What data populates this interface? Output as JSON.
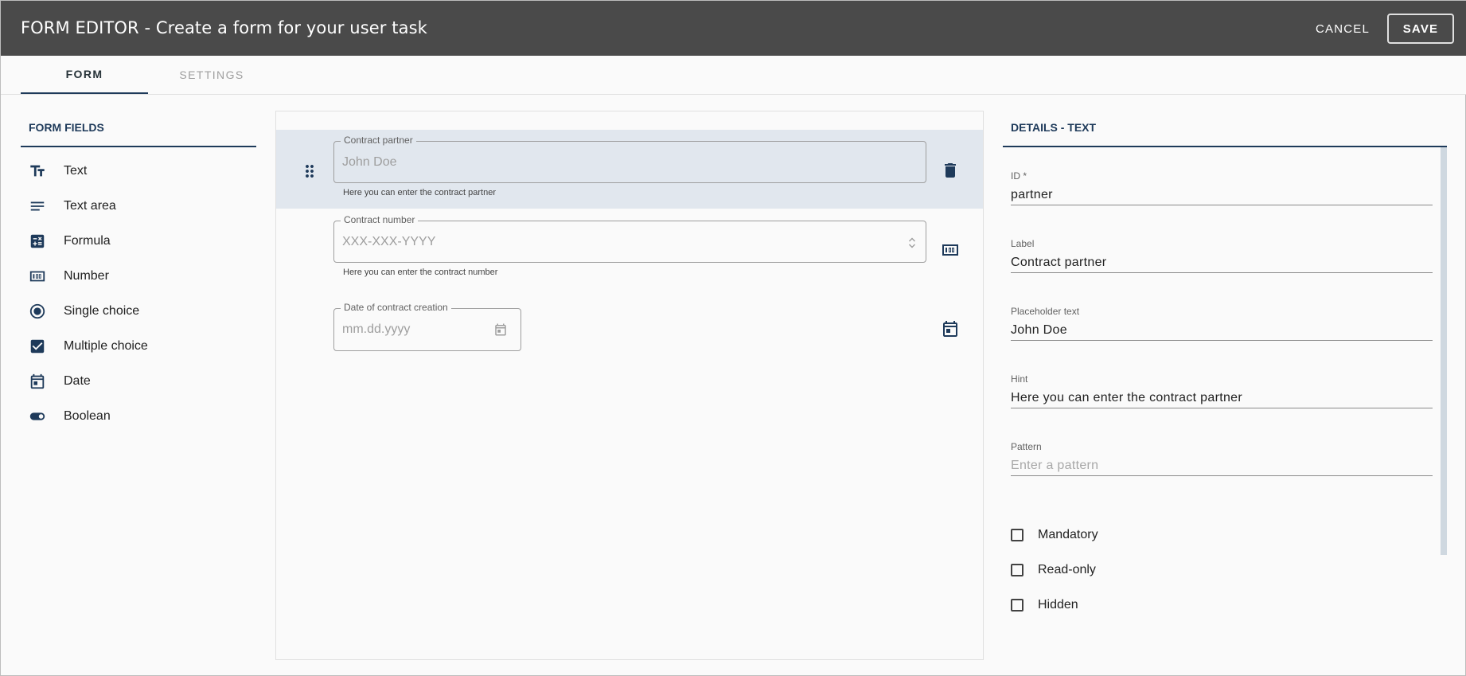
{
  "header": {
    "title": "FORM EDITOR - Create a form for your user task",
    "cancel_label": "CANCEL",
    "save_label": "SAVE"
  },
  "tabs": [
    {
      "label": "FORM",
      "active": true
    },
    {
      "label": "SETTINGS",
      "active": false
    }
  ],
  "left_panel": {
    "title": "FORM FIELDS",
    "items": [
      {
        "label": "Text",
        "icon": "text-fields-icon"
      },
      {
        "label": "Text area",
        "icon": "text-area-icon"
      },
      {
        "label": "Formula",
        "icon": "calculate-icon"
      },
      {
        "label": "Number",
        "icon": "number-icon"
      },
      {
        "label": "Single choice",
        "icon": "radio-icon"
      },
      {
        "label": "Multiple choice",
        "icon": "checkbox-icon"
      },
      {
        "label": "Date",
        "icon": "calendar-icon"
      },
      {
        "label": "Boolean",
        "icon": "toggle-icon"
      }
    ]
  },
  "canvas": {
    "fields": [
      {
        "label": "Contract partner",
        "placeholder": "John Doe",
        "hint": "Here you can enter the contract partner",
        "type": "text",
        "selected": true
      },
      {
        "label": "Contract number",
        "placeholder": "XXX-XXX-YYYY",
        "hint": "Here you can enter the contract number",
        "type": "number",
        "selected": false
      },
      {
        "label": "Date of contract creation",
        "placeholder": "mm.dd.yyyy",
        "hint": "",
        "type": "date",
        "selected": false
      }
    ]
  },
  "right_panel": {
    "title": "DETAILS - TEXT",
    "id_label": "ID *",
    "id_value": "partner",
    "label_label": "Label",
    "label_value": "Contract partner",
    "placeholder_label": "Placeholder text",
    "placeholder_value": "John Doe",
    "hint_label": "Hint",
    "hint_value": "Here you can enter the contract partner",
    "pattern_label": "Pattern",
    "pattern_placeholder": "Enter a pattern",
    "checkboxes": [
      {
        "label": "Mandatory",
        "checked": false
      },
      {
        "label": "Read-only",
        "checked": false
      },
      {
        "label": "Hidden",
        "checked": false
      }
    ]
  },
  "colors": {
    "header_bg": "#4a4a4a",
    "accent": "#1e3a5a",
    "selected_row": "#e1e7ee"
  }
}
